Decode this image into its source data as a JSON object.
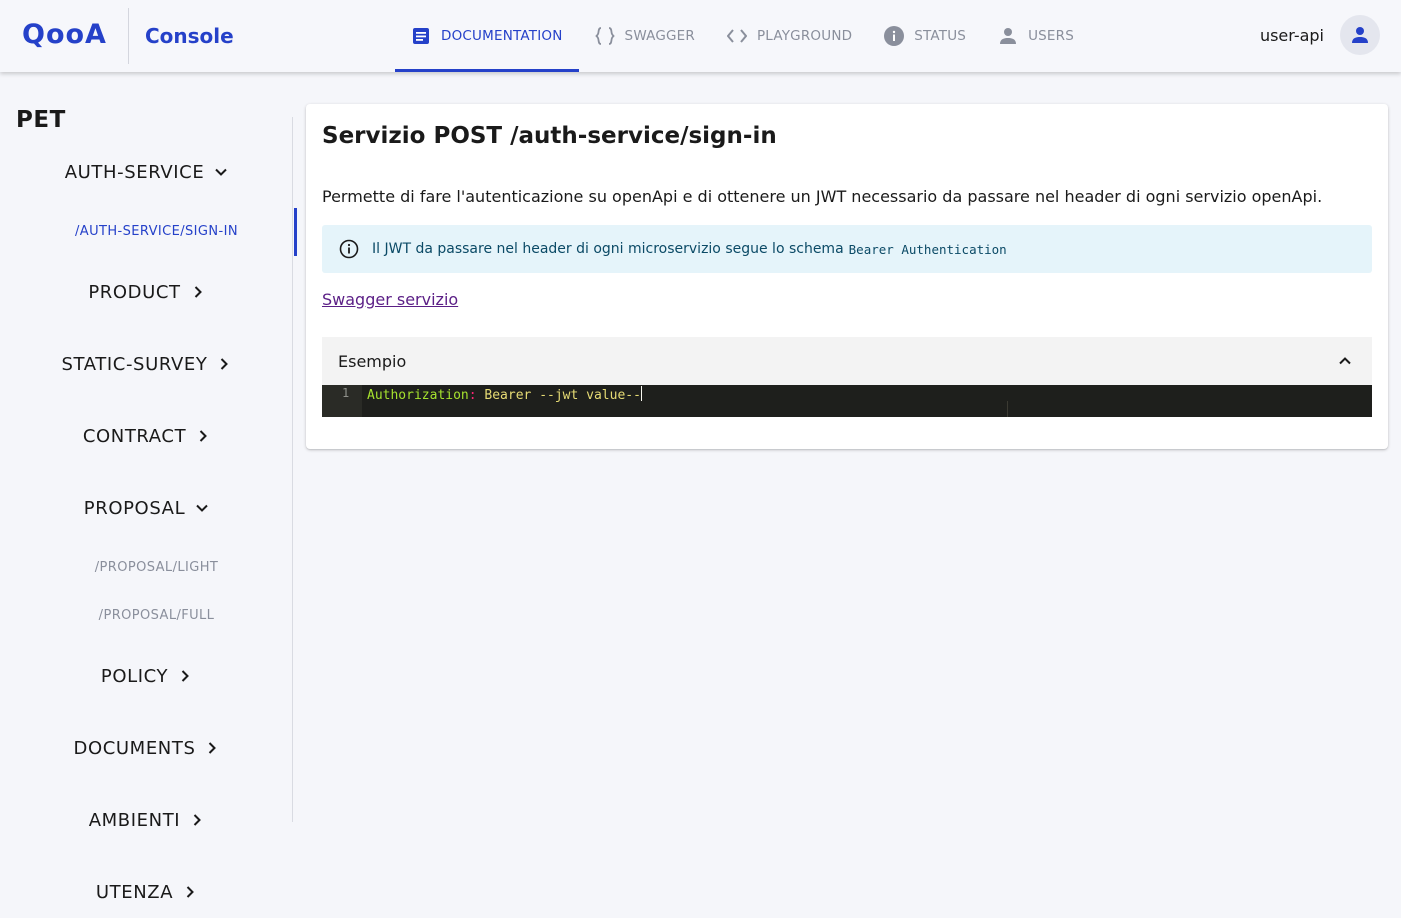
{
  "header": {
    "logo": "QooA",
    "app_title": "Console",
    "nav": [
      {
        "label": "DOCUMENTATION",
        "icon": "document-icon",
        "active": true
      },
      {
        "label": "SWAGGER",
        "icon": "braces-icon",
        "active": false
      },
      {
        "label": "PLAYGROUND",
        "icon": "code-icon",
        "active": false
      },
      {
        "label": "STATUS",
        "icon": "info-icon",
        "active": false
      },
      {
        "label": "USERS",
        "icon": "person-icon",
        "active": false
      }
    ],
    "user": "user-api",
    "avatar_icon": "person-icon"
  },
  "sidebar": {
    "section": "PET",
    "groups": [
      {
        "label": "AUTH-SERVICE",
        "chevron": "chevron-down-icon"
      },
      {
        "label": "PRODUCT",
        "chevron": "chevron-right-icon"
      },
      {
        "label": "STATIC-SURVEY",
        "chevron": "chevron-right-icon"
      },
      {
        "label": "CONTRACT",
        "chevron": "chevron-right-icon"
      },
      {
        "label": "PROPOSAL",
        "chevron": "chevron-down-icon"
      },
      {
        "label": "POLICY",
        "chevron": "chevron-right-icon"
      },
      {
        "label": "DOCUMENTS",
        "chevron": "chevron-right-icon"
      },
      {
        "label": "AMBIENTI",
        "chevron": "chevron-right-icon"
      },
      {
        "label": "UTENZA",
        "chevron": "chevron-right-icon"
      }
    ],
    "subitems": {
      "auth_sign_in": "/AUTH-SERVICE/SIGN-IN",
      "proposal_light": "/PROPOSAL/LIGHT",
      "proposal_full": "/PROPOSAL/FULL"
    }
  },
  "main": {
    "title": "Servizio POST /auth-service/sign-in",
    "description": "Permette di fare l'autenticazione su openApi e di ottenere un JWT necessario da passare nel header di ogni servizio openApi.",
    "info": {
      "text": "Il JWT da passare nel header di ogni microservizio segue lo schema",
      "code": "Bearer Authentication",
      "icon": "info-outline-icon"
    },
    "swagger_link": "Swagger servizio",
    "example": {
      "title": "Esempio",
      "line_number": "1",
      "key": "Authorization",
      "separator": ":",
      "value": " Bearer --jwt value--"
    }
  },
  "colors": {
    "accent": "#2541c9",
    "info_bg": "#e5f4fa",
    "link": "#5b1f86",
    "editor_bg": "#1e1f1c"
  }
}
